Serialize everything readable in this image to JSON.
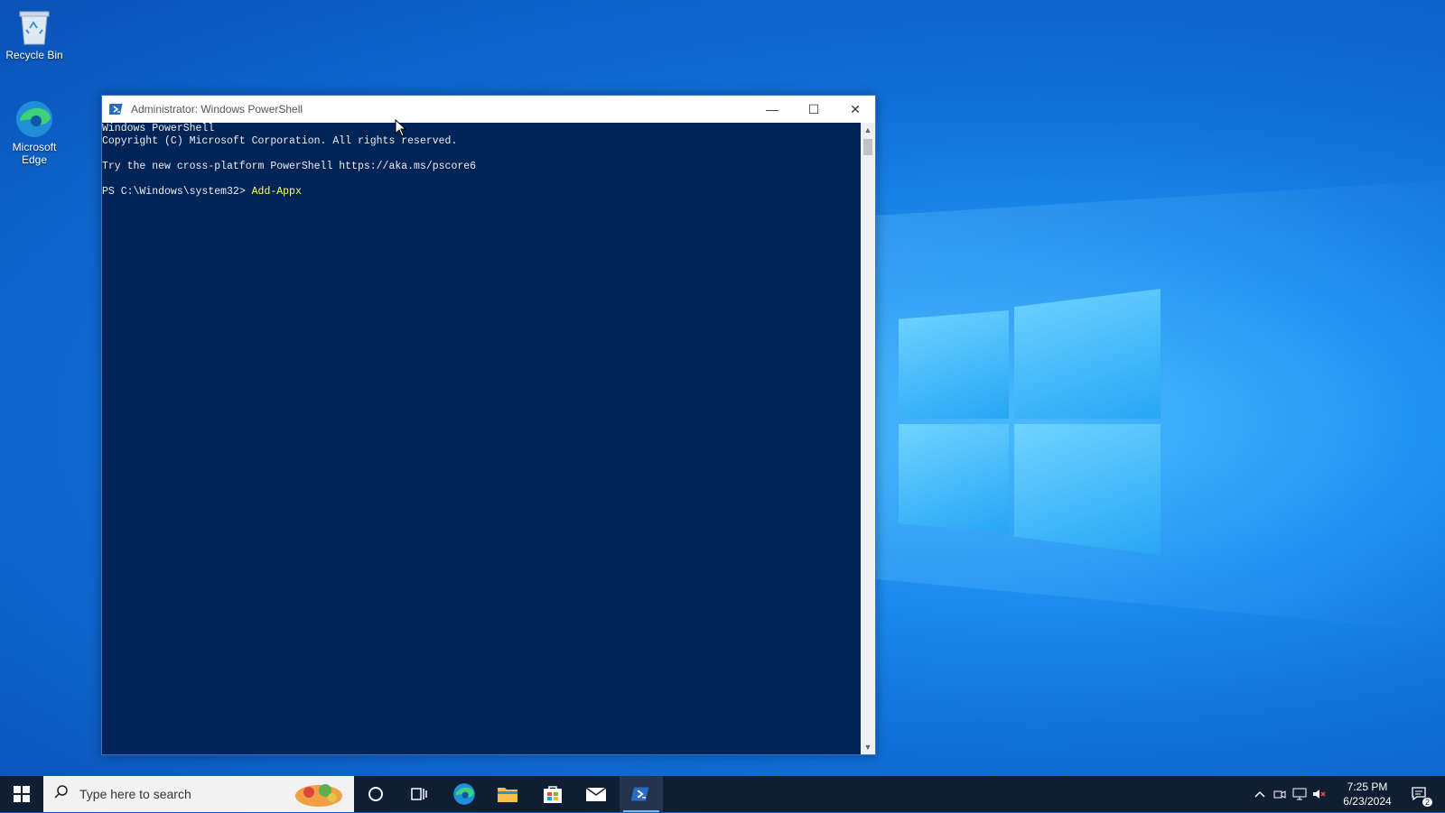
{
  "desktop": {
    "icons": [
      {
        "label": "Recycle Bin",
        "icon": "recycle-bin-icon"
      },
      {
        "label": "Microsoft Edge",
        "icon": "edge-icon"
      }
    ]
  },
  "window": {
    "title": "Administrator: Windows PowerShell",
    "buttons": {
      "minimize": "—",
      "maximize": "☐",
      "close": "✕"
    }
  },
  "console": {
    "lines": [
      "Windows PowerShell",
      "Copyright (C) Microsoft Corporation. All rights reserved.",
      "",
      "Try the new cross-platform PowerShell https://aka.ms/pscore6",
      ""
    ],
    "prompt": "PS C:\\Windows\\system32> ",
    "command": "Add-Appx"
  },
  "taskbar": {
    "search_placeholder": "Type here to search",
    "clock_time": "7:25 PM",
    "clock_date": "6/23/2024",
    "notification_count": "2",
    "pinned": [
      "cortana-icon",
      "task-view-icon",
      "edge-icon",
      "file-explorer-icon",
      "store-icon",
      "mail-icon",
      "powershell-icon"
    ]
  },
  "colors": {
    "console_bg": "#012456",
    "console_text": "#eeedf0",
    "command_text": "#ffff66",
    "taskbar_bg": "#0f1e33"
  }
}
